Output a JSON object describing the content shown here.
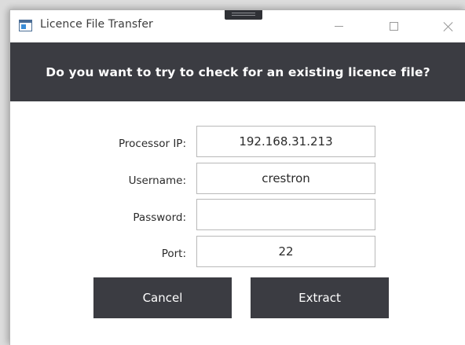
{
  "window": {
    "title": "Licence File Transfer",
    "icons": {
      "app": "app-window-icon",
      "minimize": "minimize-icon",
      "maximize": "maximize-icon",
      "close": "close-icon"
    }
  },
  "banner": {
    "text": "Do you want to try to check for an existing licence file?"
  },
  "form": {
    "processor_ip": {
      "label": "Processor IP:",
      "value": "192.168.31.213"
    },
    "username": {
      "label": "Username:",
      "value": "crestron"
    },
    "password": {
      "label": "Password:",
      "value": ""
    },
    "port": {
      "label": "Port:",
      "value": "22"
    }
  },
  "buttons": {
    "cancel": "Cancel",
    "extract": "Extract"
  },
  "colors": {
    "banner_bg": "#3b3c42",
    "button_bg": "#3b3c42",
    "button_text": "#ffffff"
  }
}
